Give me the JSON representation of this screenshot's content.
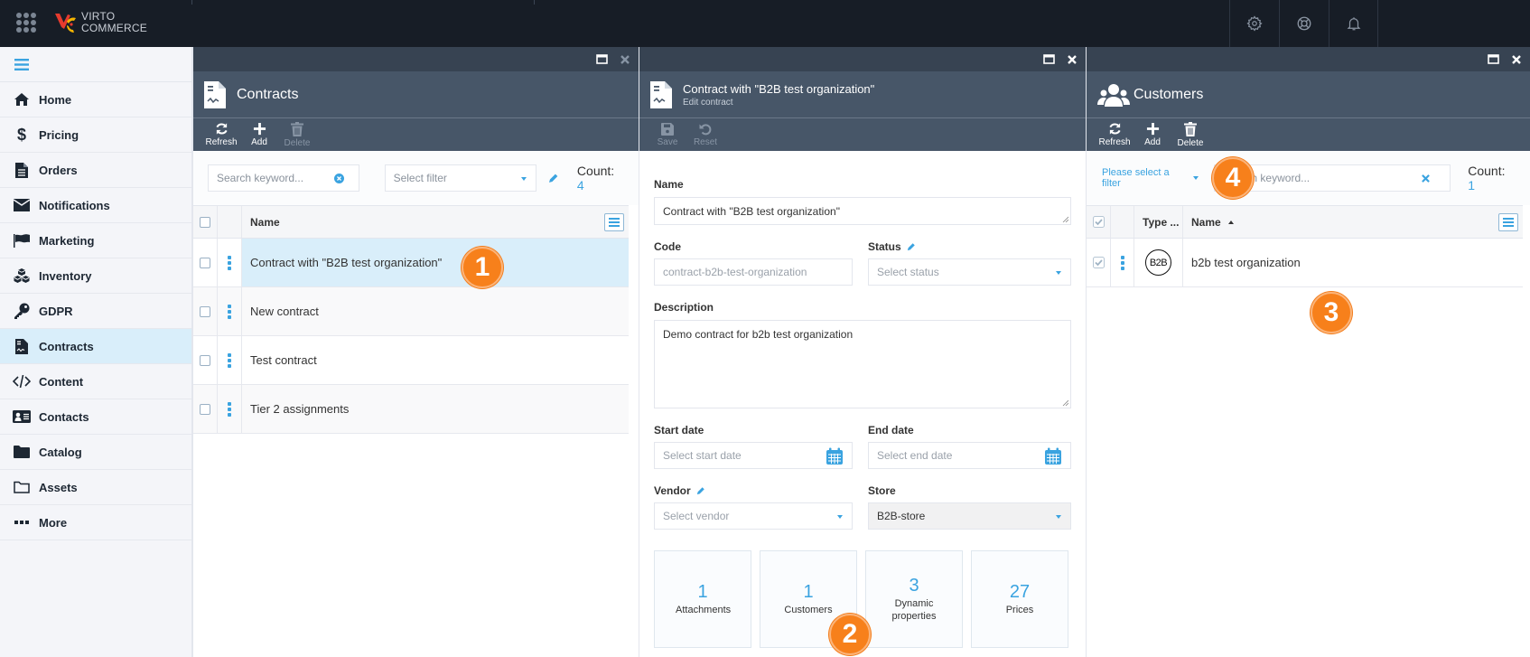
{
  "app": {
    "logo_line1": "VIRTO",
    "logo_line2": "COMMERCE"
  },
  "topbar": {
    "icons": [
      "gear-icon",
      "lifebuoy-icon",
      "bell-icon"
    ]
  },
  "sidebar": {
    "items": [
      {
        "label": "Home",
        "icon": "home-icon"
      },
      {
        "label": "Pricing",
        "icon": "dollar-icon"
      },
      {
        "label": "Orders",
        "icon": "document-icon"
      },
      {
        "label": "Notifications",
        "icon": "envelope-icon"
      },
      {
        "label": "Marketing",
        "icon": "flag-icon"
      },
      {
        "label": "Inventory",
        "icon": "cubes-icon"
      },
      {
        "label": "GDPR",
        "icon": "key-icon"
      },
      {
        "label": "Contracts",
        "icon": "contract-icon",
        "active": true
      },
      {
        "label": "Content",
        "icon": "code-icon"
      },
      {
        "label": "Contacts",
        "icon": "id-card-icon"
      },
      {
        "label": "Catalog",
        "icon": "folder-icon"
      },
      {
        "label": "Assets",
        "icon": "folder-open-icon"
      },
      {
        "label": "More",
        "icon": "more-icon"
      }
    ]
  },
  "contracts_blade": {
    "title": "Contracts",
    "toolbar": {
      "refresh": "Refresh",
      "add": "Add",
      "delete": "Delete"
    },
    "search_placeholder": "Search keyword...",
    "filter_placeholder": "Select filter",
    "count_label": "Count:",
    "count": "4",
    "column_name": "Name",
    "rows": [
      {
        "name": "Contract with \"B2B test organization\"",
        "selected": true
      },
      {
        "name": "New contract"
      },
      {
        "name": "Test contract"
      },
      {
        "name": "Tier 2 assignments"
      }
    ]
  },
  "edit_blade": {
    "title": "Contract with \"B2B test organization\"",
    "subtitle": "Edit contract",
    "toolbar": {
      "save": "Save",
      "reset": "Reset"
    },
    "name_label": "Name",
    "name_value": "Contract with \"B2B test organization\"",
    "code_label": "Code",
    "code_value": "contract-b2b-test-organization",
    "status_label": "Status",
    "status_placeholder": "Select status",
    "description_label": "Description",
    "description_value": "Demo contract for b2b test organization",
    "start_date_label": "Start date",
    "start_date_placeholder": "Select start date",
    "end_date_label": "End date",
    "end_date_placeholder": "Select end date",
    "vendor_label": "Vendor",
    "vendor_placeholder": "Select vendor",
    "store_label": "Store",
    "store_value": "B2B-store",
    "widgets": [
      {
        "count": "1",
        "label": "Attachments"
      },
      {
        "count": "1",
        "label": "Customers"
      },
      {
        "count": "3",
        "label": "Dynamic properties"
      },
      {
        "count": "27",
        "label": "Prices"
      }
    ]
  },
  "customers_blade": {
    "title": "Customers",
    "toolbar": {
      "refresh": "Refresh",
      "add": "Add",
      "delete": "Delete"
    },
    "filter_link": "Please select a filter",
    "search_placeholder": "Search keyword...",
    "count_label": "Count:",
    "count": "1",
    "column_type": "Type ...",
    "column_name": "Name",
    "rows": [
      {
        "type_badge": "B2B",
        "name": "b2b test organization"
      }
    ]
  },
  "callouts": [
    "1",
    "2",
    "3",
    "4"
  ],
  "colors": {
    "accent": "#3aa3e0",
    "callout": "#f7801b",
    "topbar": "#171d26",
    "blade_header": "#475668"
  }
}
